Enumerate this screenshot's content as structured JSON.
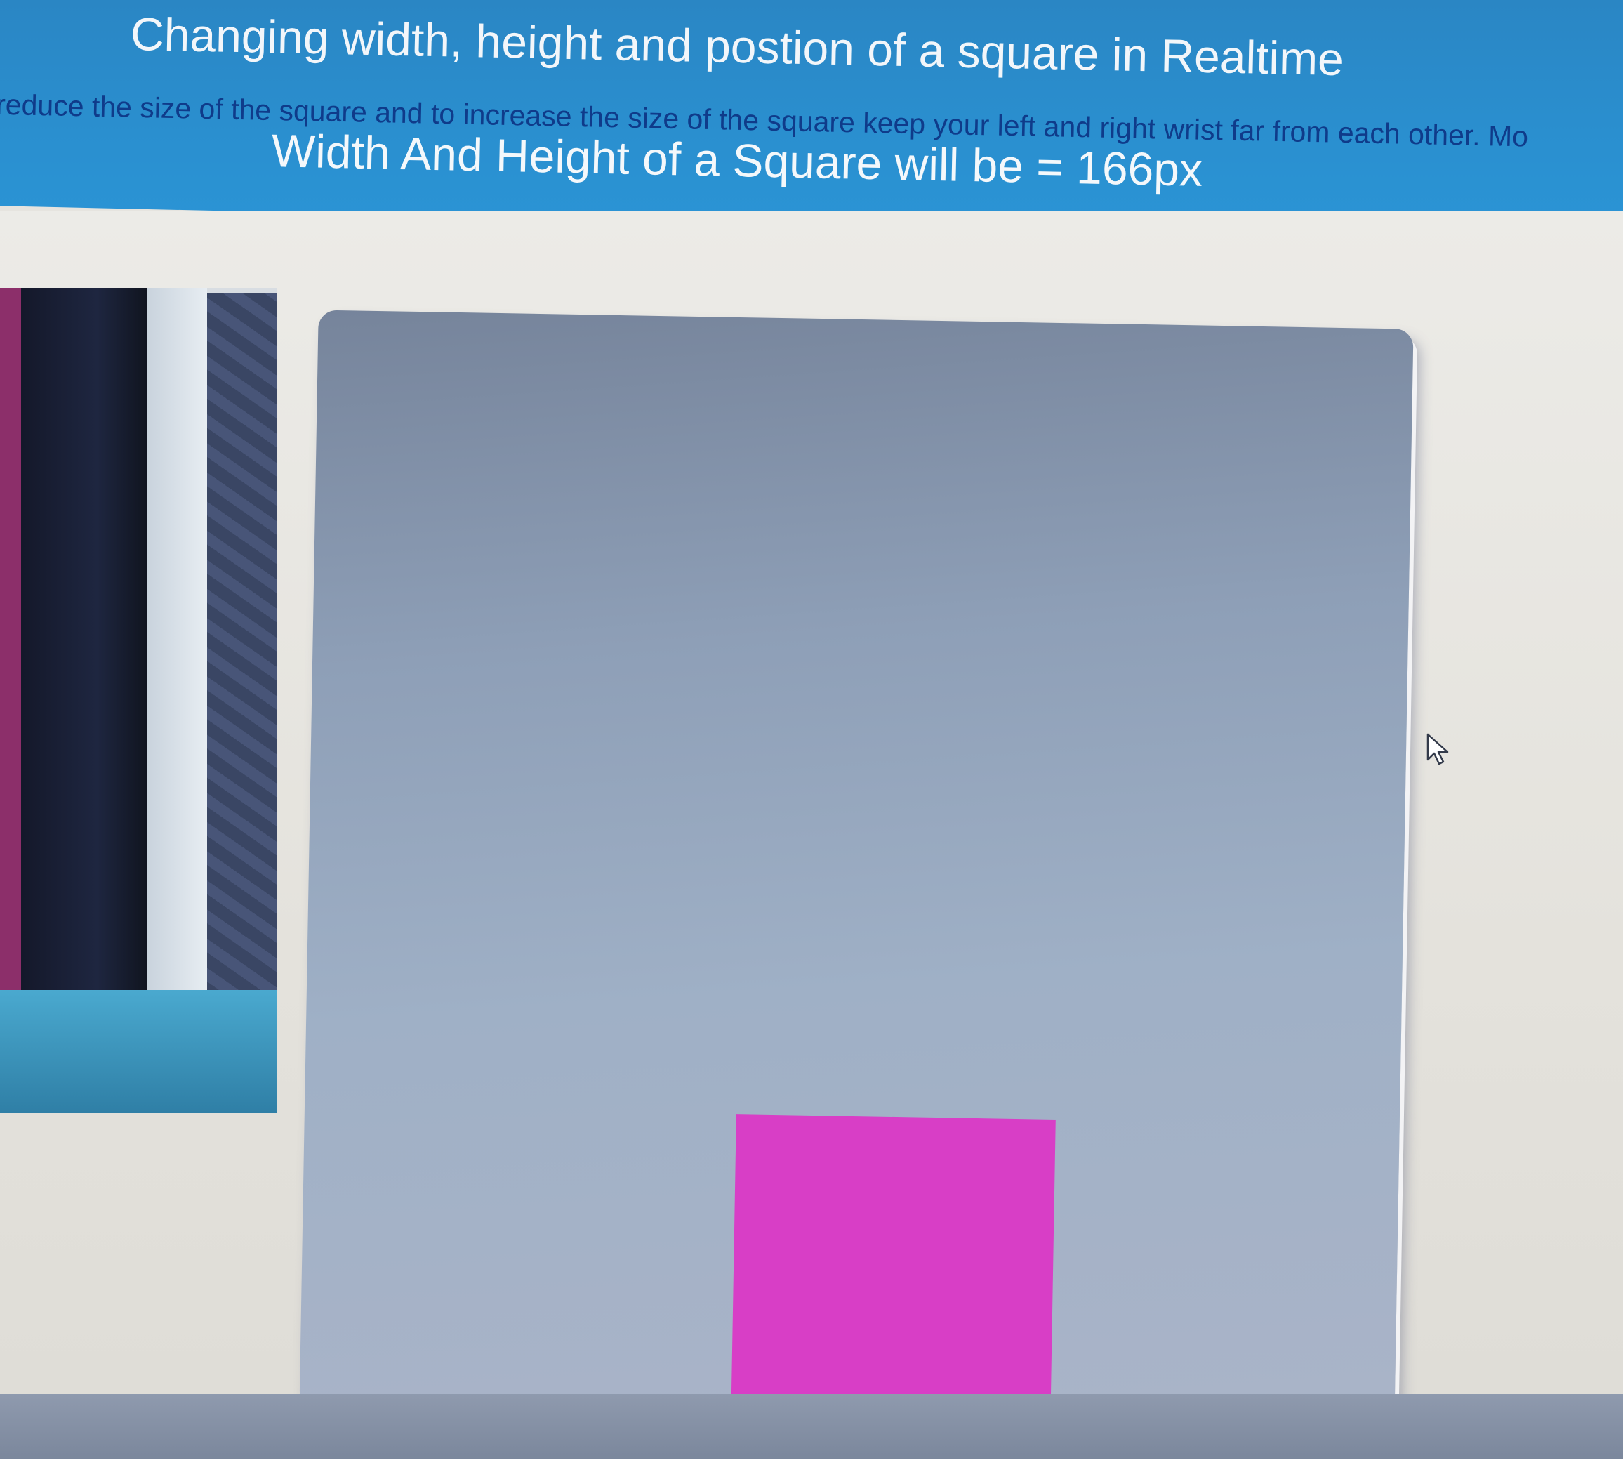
{
  "header": {
    "title": "Changing width, height and postion of a square in Realtime",
    "instructions": "o reduce the size of the square and to increase the size of the square keep your left and right wrist far from each other. Mo",
    "size_label": "Width And Height of a Square will be =",
    "size_value": "166px"
  },
  "colors": {
    "header_blue": "#2a8fcf",
    "square_magenta": "#d83ec6",
    "stage_gray": "#9fb0c6"
  },
  "cursor": {
    "icon": "mouse-pointer-icon"
  }
}
